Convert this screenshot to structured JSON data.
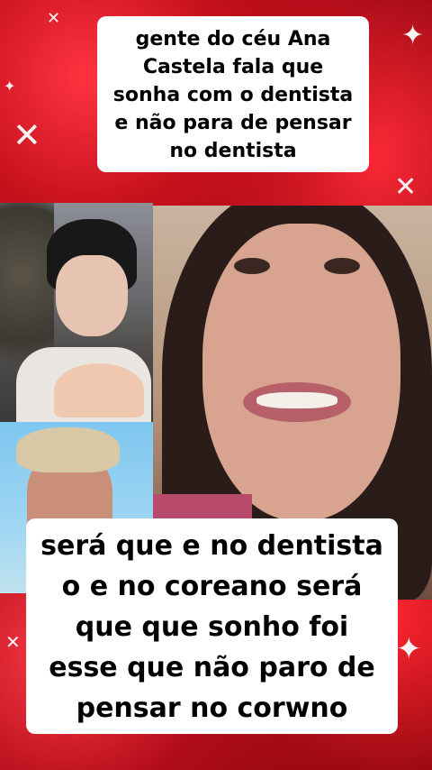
{
  "caption_top": {
    "lines": [
      "gente do céu Ana",
      "Castela fala que",
      "sonha com o dentista",
      "e não para de pensar",
      "no dentista"
    ]
  },
  "caption_bottom": {
    "lines": [
      "será que e no dentista",
      "o  e no coreano será",
      "que  que sonho foi",
      "esse que não paro de",
      "pensar no corwno"
    ]
  },
  "photos": {
    "top_left": "korean-man-heart-hands",
    "bottom_left": "blond-man",
    "right": "woman-talking"
  },
  "colors": {
    "background_red": "#c8141e",
    "caption_bg": "#ffffff",
    "caption_text": "#000000"
  }
}
